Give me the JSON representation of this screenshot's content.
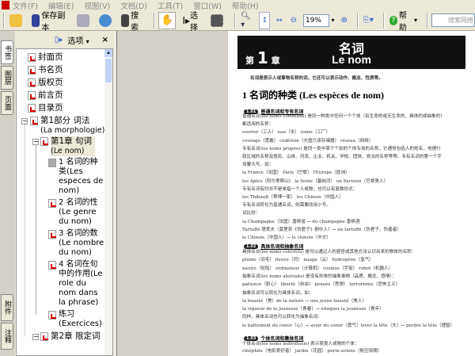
{
  "menubar": [
    "文件(F)",
    "编辑(E)",
    "视图(V)",
    "文档(D)",
    "工具(T)",
    "窗口(W)",
    "帮助(H)"
  ],
  "toolbar": {
    "save_copy": "保存副本",
    "search": "搜索",
    "select": "选择",
    "zoom_value": "19%",
    "help": "帮助",
    "search_web_placeholder": "搜索网络"
  },
  "left_tabs": [
    "书签",
    "图层",
    "页面",
    "附件",
    "注释"
  ],
  "panel": {
    "options": "选项",
    "close": "×"
  },
  "tree": [
    {
      "label": "封面页"
    },
    {
      "label": "书名页"
    },
    {
      "label": "版权页"
    },
    {
      "label": "前言页"
    },
    {
      "label": "目录页"
    },
    {
      "label": "第1部分 词法",
      "sub": "(La morphologie)"
    },
    {
      "label": "第1章 句词",
      "sub": "(Le nom)"
    },
    {
      "label": "1 名词的种类(Les especes de nom)"
    },
    {
      "label": "2 名词的性(Le genre du nom)"
    },
    {
      "label": "3 名词的数(Le nombre du nom)"
    },
    {
      "label": "4 名词在句中的作用(Le role du nom dans la phrase)"
    },
    {
      "label": "练习(Exercices)"
    },
    {
      "label": "第2章 限定词"
    }
  ],
  "page": {
    "chapter_prefix": "第",
    "chapter_num": "1",
    "chapter_suffix": "章",
    "title_cn": "名词",
    "title_fr": "Le nom",
    "intro": "名词是表示人或事物名称的词，它还可以表示动作、概念、性质等。",
    "heading": "1  名词的种类 (Les espèces de nom)",
    "sections": [
      {
        "badge": "1.01",
        "title": "普通名词和专有名词"
      },
      {
        "badge": "1.02",
        "title": "具体名词和抽象名词"
      },
      {
        "badge": "1.03",
        "title": "个体名词和集体名词"
      }
    ],
    "lines1": [
      "普通名词(les noms communs) 是同一种类中任何一个个体（有生命的或无生命的、具体的或抽象的）",
      "都适用的名称：",
      "      ouvrier（工人）        eau（水）                    usine（工厂）",
      "      courage（勇敢）      cédérom（光盘只读存储器）     réseau（网络）",
      "   专有名词(les noms propres) 是同一类中某个个别的个体专用的名称，它通常包括人的姓名、地理行",
      "政区域的名称及居民、山体、河流、企业、机关、学校、团体、党派的名称等等。专有名词的第一个字",
      "母要大写。如：",
      "      la France（法国）         Paris（巴黎）          l'Europe（欧洲）",
      "      les Aples（阿尔卑斯山）   la Seine（塞纳河）     un Parisien（巴黎男人）",
      "   专有名词有时并不是单指一个人或物，也可以有复数形式：",
      "      les Thibault（蒂博一家）     les Chinois（中国人）",
      "   专有名词转化为普通名词，则需要改用小写。",
      "   试比较：",
      "      la Champagne（法国）香槟省 → du champagne 香槟酒",
      "      Tartuffe 塔丢夫（莫里哀《伪君子》剧中人）→ un tartuffe（伪君子，伪善者）",
      "      le Chinois（中国人）→ le chinois（中文）"
    ],
    "lines2": [
      "具体名词(les noms concrets) 是可以通过人的感官或其他方法认识出来的物体的名称：",
      "      plume（羽毛）   fleuve（河）        nuage（云）        hydrogène（氢气）",
      "      navire（轮船）  ordinateur（计算机） cosmos（宇宙）      robot（机器人）",
      "抽象名词(les noms abstraits) 是没有形体的抽象事物（品质、概念、感情）：",
      "      patience（耐心）  liberté（自由）     pensée（思想）     terrorisme（恐怖主义）",
      "抽象名词可以转化为具体名词，如：",
      "   la beauté（美）de la nature → une jeune beauté（美人）",
      "   la vigueur de la jeunesse（青春）→ éduquer la jeunesse（青年）",
      "同样，具体名词也可以转化为抽象名词：",
      "   le battement du coeur（心）→ avoir du coeur（勇气）lever la tête（头）→ perdre la tête（理智）"
    ],
    "lines3": [
      "个体名词(les noms individuels) 表示某类人或物的个体：",
      "      cinéphile（电影爱好者）      jardin（花园）        porte-avions（航空母舰）"
    ]
  }
}
